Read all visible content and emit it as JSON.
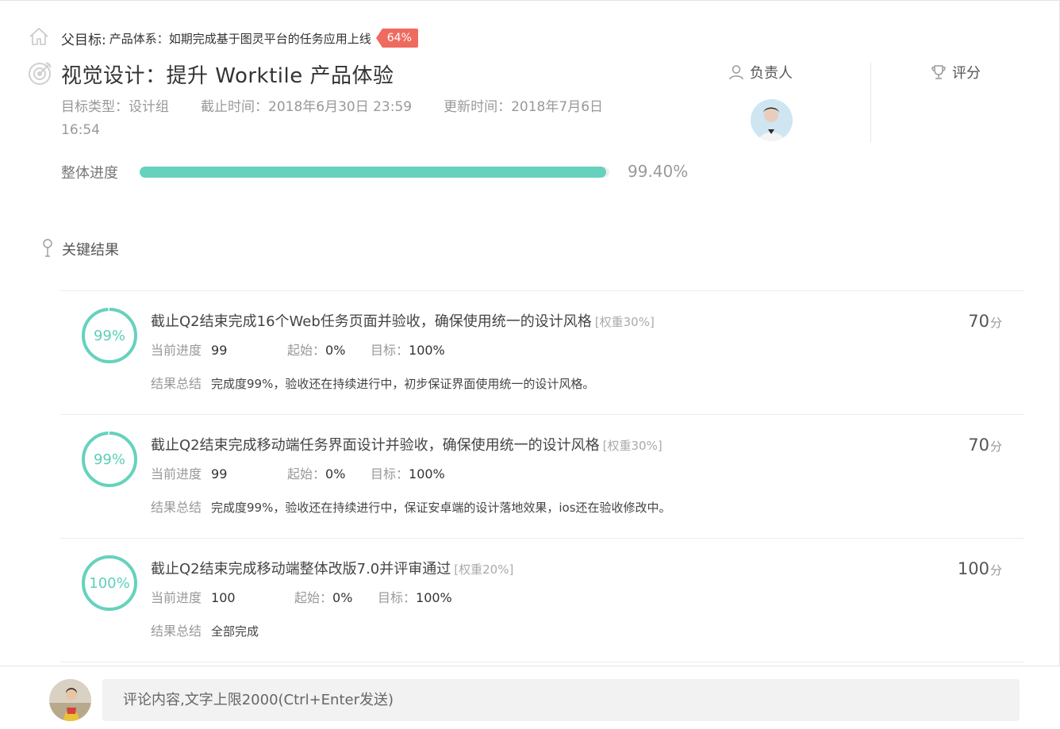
{
  "parent": {
    "label": "父目标:",
    "text": "产品体系：如期完成基于图灵平台的任务应用上线",
    "badge": "64%"
  },
  "objective": {
    "title": "视觉设计：提升 Worktile 产品体验",
    "type": "目标类型：设计组",
    "deadline": "截止时间：2018年6月30日 23:59",
    "updated": "更新时间：2018年7月6日 16:54",
    "progress_label": "整体进度",
    "progress_value": "99.40%",
    "progress": 0.994
  },
  "owner": {
    "label": "负责人"
  },
  "score": {
    "label": "评分"
  },
  "key_results": {
    "header": "关键结果",
    "labels": {
      "current": "当前进度",
      "start": "起始：",
      "target": "目标：",
      "summary": "结果总结",
      "score_unit": "分"
    },
    "items": [
      {
        "percent_label": "99%",
        "progress": 0.99,
        "title": "截止Q2结束完成16个Web任务页面并验收，确保使用统一的设计风格",
        "weight": "[权重30%]",
        "current": "99",
        "start": "0%",
        "target": "100%",
        "summary": "完成度99%，验收还在持续进行中，初步保证界面使用统一的设计风格。",
        "score": "70"
      },
      {
        "percent_label": "99%",
        "progress": 0.99,
        "title": "截止Q2结束完成移动端任务界面设计并验收，确保使用统一的设计风格",
        "weight": "[权重30%]",
        "current": "99",
        "start": "0%",
        "target": "100%",
        "summary": "完成度99%，验收还在持续进行中，保证安卓端的设计落地效果，ios还在验收修改中。",
        "score": "70"
      },
      {
        "percent_label": "100%",
        "progress": 1.0,
        "title": "截止Q2结束完成移动端整体改版7.0并评审通过",
        "weight": "[权重20%]",
        "current": "100",
        "start": "0%",
        "target": "100%",
        "summary": "全部完成",
        "score": "100"
      }
    ]
  },
  "comment": {
    "placeholder": "评论内容,文字上限2000(Ctrl+Enter发送)"
  },
  "colors": {
    "accent": "#66d2bd",
    "badge": "#ef6b60"
  }
}
